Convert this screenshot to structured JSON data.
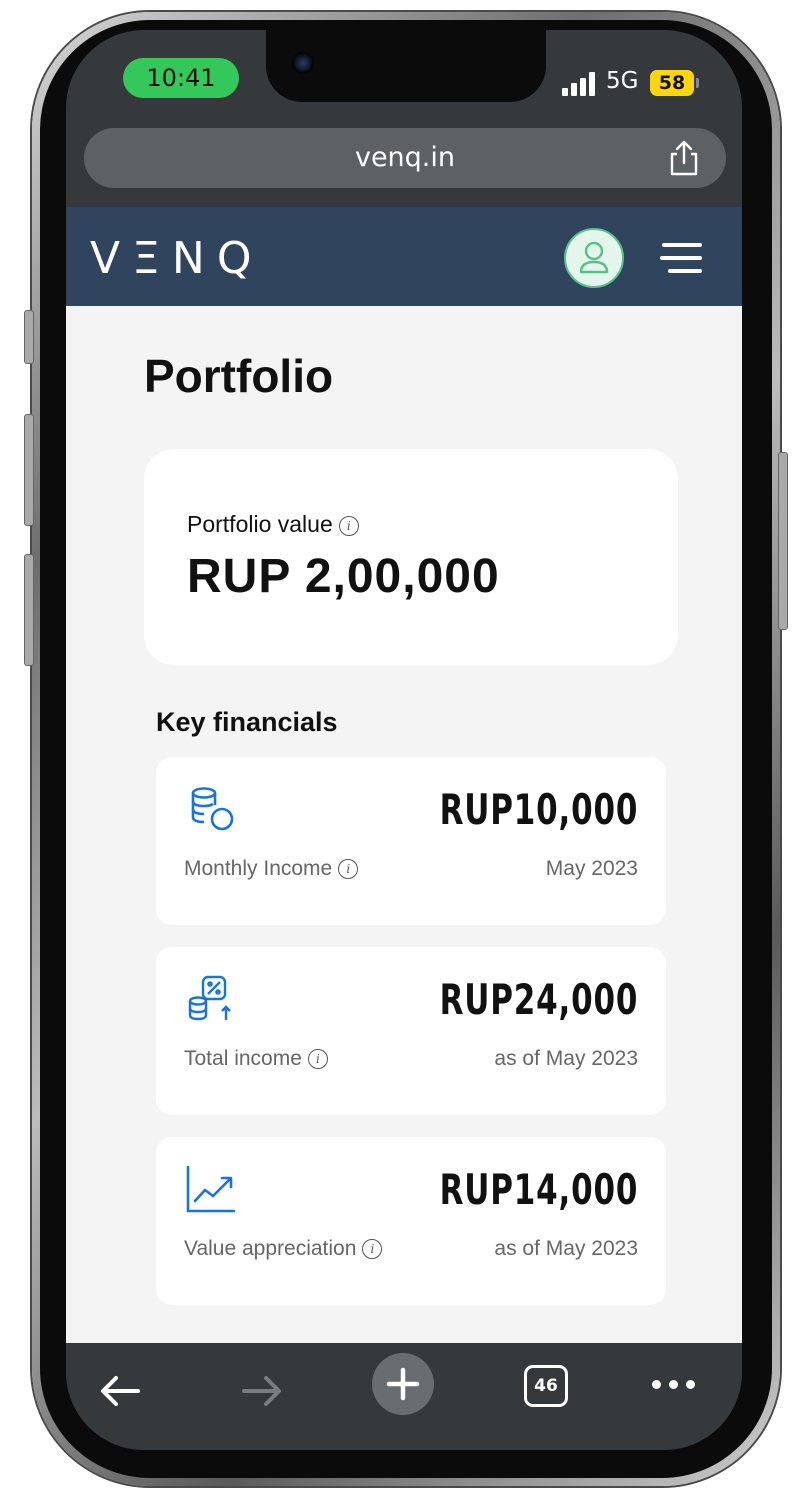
{
  "status_bar": {
    "time": "10:41",
    "network": "5G",
    "battery": "58"
  },
  "browser": {
    "url": "venq.in",
    "tab_count": "46"
  },
  "header": {
    "logo_text": "VΞNQ"
  },
  "page": {
    "title": "Portfolio",
    "portfolio_value": {
      "label": "Portfolio value",
      "amount": "RUP 2,00,000"
    },
    "key_financials": {
      "title": "Key financials",
      "items": [
        {
          "icon": "database-coins-icon",
          "amount": "RUP10,000",
          "label": "Monthly Income",
          "date": "May 2023"
        },
        {
          "icon": "income-growth-icon",
          "amount": "RUP24,000",
          "label": "Total income",
          "date": "as of May 2023"
        },
        {
          "icon": "trend-up-chart-icon",
          "amount": "RUP14,000",
          "label": "Value appreciation",
          "date": "as of May 2023"
        }
      ]
    }
  },
  "colors": {
    "header_bg": "#30445e",
    "page_bg": "#f4f4f4",
    "accent_blue": "#1a73d9",
    "avatar_green": "#58c08a",
    "time_pill": "#34c759",
    "battery": "#ffd60a"
  }
}
